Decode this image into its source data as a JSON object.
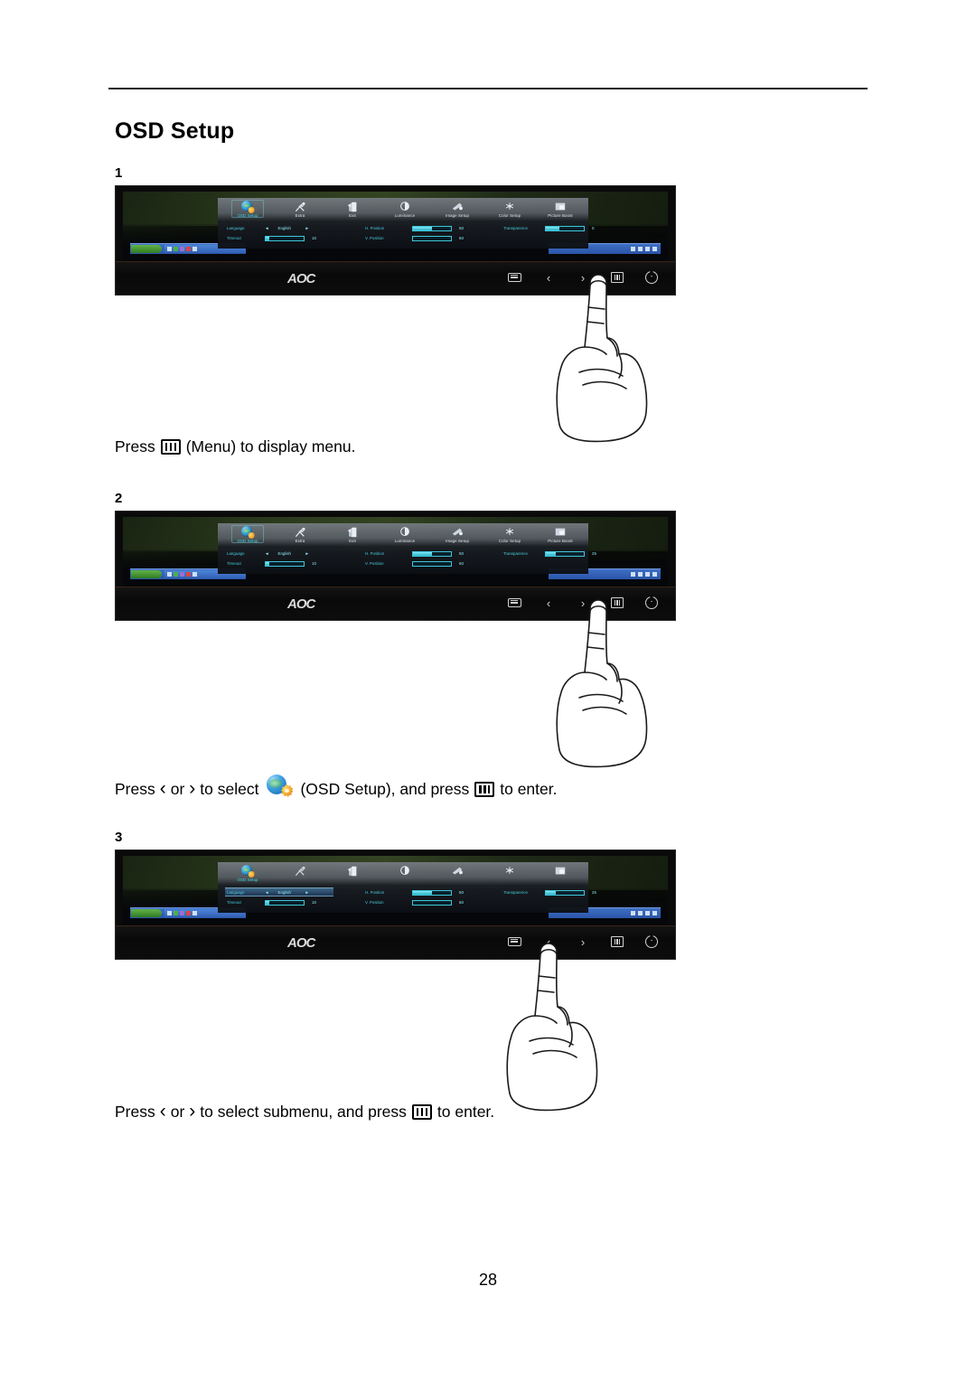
{
  "document": {
    "page_title": "OSD Setup",
    "page_number": "28"
  },
  "steps": [
    {
      "number": "1",
      "caption_before": "Press",
      "caption_icon": "menu-icon",
      "caption_after": "(Menu) to display menu.",
      "pressed_button": "menu"
    },
    {
      "number": "2",
      "caption_before": "Press",
      "caption_left": "‹",
      "caption_or": "or",
      "caption_right": "›",
      "caption_mid": "to select",
      "caption_icon": "osd-setup-globe-icon",
      "caption_after": "(OSD Setup), and press",
      "caption_tail": "to enter.",
      "pressed_button": "menu"
    },
    {
      "number": "3",
      "caption_before": "Press",
      "caption_left": "‹",
      "caption_or": "or",
      "caption_right": "›",
      "caption_mid": "to select submenu, and press",
      "caption_tail": "to enter.",
      "pressed_button": "left"
    }
  ],
  "osd": {
    "brand": "AOC",
    "menu_items": [
      {
        "label": "OSD Setup",
        "icon": "globe-gear-icon",
        "selected": true
      },
      {
        "label": "Extra",
        "icon": "wrench-icon",
        "selected": false
      },
      {
        "label": "Exit",
        "icon": "exit-door-icon",
        "selected": false
      },
      {
        "label": "Luminance",
        "icon": "brightness-icon",
        "selected": false
      },
      {
        "label": "Image Setup",
        "icon": "image-icon",
        "selected": false
      },
      {
        "label": "Color Setup",
        "icon": "color-icon",
        "selected": false
      },
      {
        "label": "Picture Boost",
        "icon": "boost-icon",
        "selected": false
      }
    ],
    "settings": {
      "language": {
        "label": "Language",
        "value": "English",
        "left_arrow": "◄",
        "right_arrow": "►"
      },
      "timeout": {
        "label": "Timeout",
        "value": "10",
        "percent": 10
      },
      "h_position": {
        "label": "H. Position",
        "value": "50",
        "percent": 50
      },
      "v_position": {
        "label": "V. Position",
        "value": "60",
        "percent": 60
      },
      "transparence": {
        "label": "Transparence",
        "value_step1": "0",
        "value_step2": "25",
        "percent_step1": 35,
        "percent_step2": 25
      }
    },
    "bezel_buttons": [
      {
        "name": "source-button",
        "icon": "source-icon"
      },
      {
        "name": "left-button",
        "icon": "chevron-left-icon",
        "glyph": "‹"
      },
      {
        "name": "right-button",
        "icon": "chevron-right-icon",
        "glyph": "›"
      },
      {
        "name": "menu-button",
        "icon": "menu-icon"
      },
      {
        "name": "power-button",
        "icon": "power-icon"
      }
    ]
  },
  "colors": {
    "osd_text": "#4fd5e6",
    "osd_selected": "#3fd8e8",
    "bezel": "#0d0d0d",
    "accent_gear": "#f2981e",
    "accent_globe": "#3ea4e2"
  }
}
